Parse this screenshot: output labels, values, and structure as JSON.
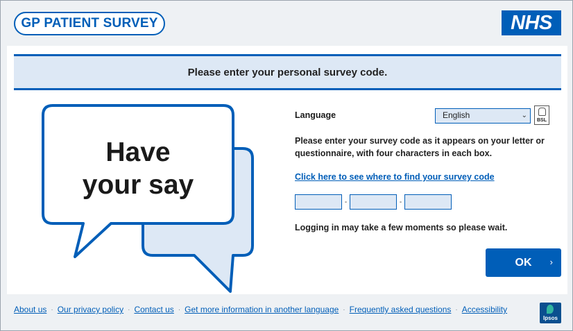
{
  "header": {
    "survey_logo_text": "GP PATIENT SURVEY",
    "nhs_logo_text": "NHS"
  },
  "banner": {
    "text": "Please enter your personal survey code."
  },
  "illustration": {
    "line1": "Have",
    "line2": "your say"
  },
  "form": {
    "language_label": "Language",
    "language_value": "English",
    "bsl_label": "BSL",
    "instructions": "Please enter your survey code as it appears on your letter or questionnaire, with four characters in each box.",
    "find_code_link": "Click here to see where to find your survey code",
    "code_separator": "-",
    "code_boxes": [
      "",
      "",
      ""
    ],
    "wait_text": "Logging in may take a few moments so please wait.",
    "ok_label": "OK",
    "ok_chevron": "›"
  },
  "footer": {
    "links": [
      "About us",
      "Our privacy policy",
      "Contact us",
      "Get more information in another language",
      "Frequently asked questions",
      "Accessibility"
    ],
    "separator": "·",
    "partner_logo_text": "Ipsos"
  },
  "colors": {
    "brand_blue": "#005eb8",
    "banner_bg": "#dde8f5",
    "page_bg": "#eef1f4"
  }
}
